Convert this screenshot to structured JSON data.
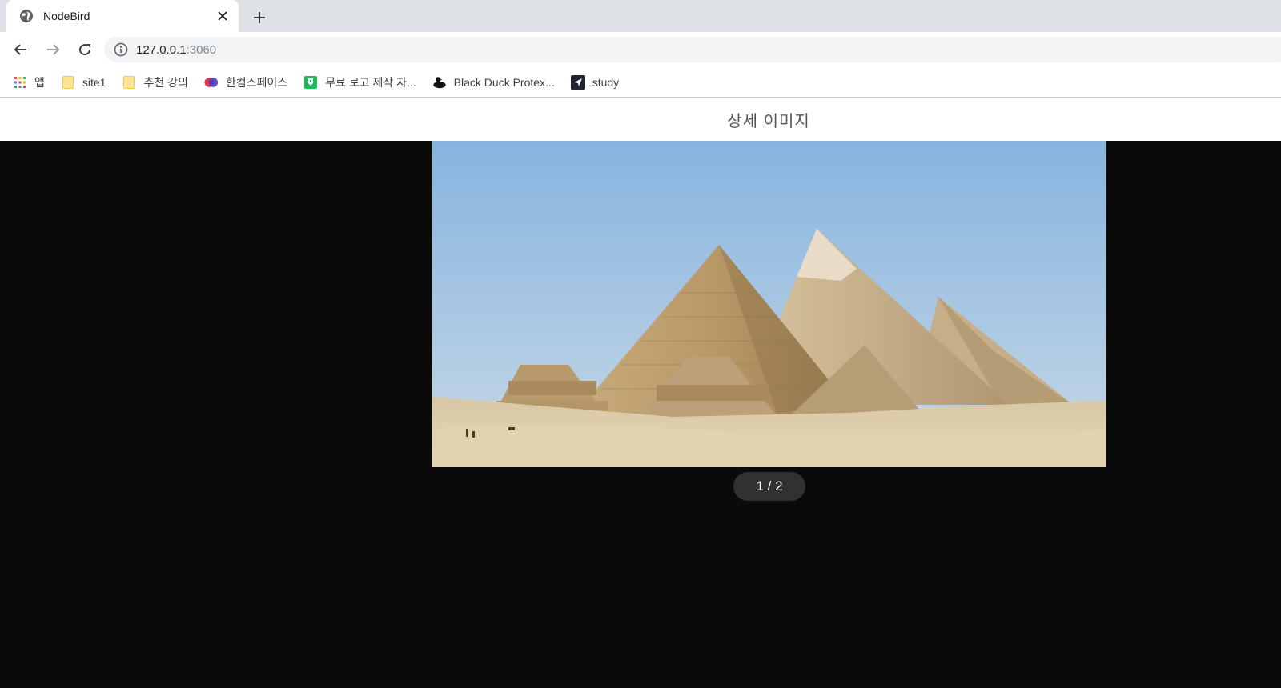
{
  "browser": {
    "tab": {
      "title": "NodeBird",
      "icon": "globe-icon"
    },
    "address": {
      "host": "127.0.0.1",
      "port": ":3060"
    },
    "bookmarks": [
      {
        "label": "앱",
        "icon": "apps-grid-icon"
      },
      {
        "label": "site1",
        "icon": "folder-icon"
      },
      {
        "label": "추천 강의",
        "icon": "folder-icon"
      },
      {
        "label": "한컴스페이스",
        "icon": "hancom-logo-icon"
      },
      {
        "label": "무료 로고 제작 자...",
        "icon": "green-shield-icon"
      },
      {
        "label": "Black Duck Protex...",
        "icon": "black-duck-icon"
      },
      {
        "label": "study",
        "icon": "study-icon"
      }
    ]
  },
  "page": {
    "header_title": "상세 이미지",
    "image_counter": "1 / 2",
    "image_subject": "pyramids-of-giza-photo"
  },
  "colors": {
    "viewer_bg": "#0a0a0a",
    "counter_bg": "#313131",
    "tabstrip_bg": "#dee1e6"
  }
}
